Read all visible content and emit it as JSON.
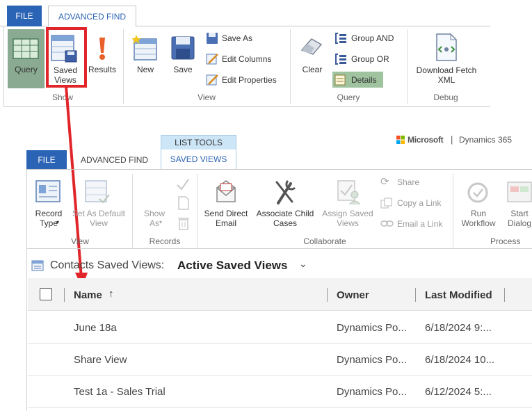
{
  "top_ribbon": {
    "tabs": {
      "file": "FILE",
      "advanced_find": "ADVANCED FIND"
    },
    "show": {
      "query": "Query",
      "saved_views": "Saved\nViews",
      "results": "Results",
      "section": "Show"
    },
    "view": {
      "new": "New",
      "save": "Save",
      "save_as": "Save As",
      "edit_columns": "Edit Columns",
      "edit_properties": "Edit Properties",
      "section": "View"
    },
    "query": {
      "clear": "Clear",
      "group_and": "Group AND",
      "group_or": "Group OR",
      "details": "Details",
      "section": "Query"
    },
    "debug": {
      "download_fetch_xml": "Download Fetch\nXML",
      "section": "Debug"
    }
  },
  "bottom_ribbon": {
    "brand": {
      "microsoft": "Microsoft",
      "product": "Dynamics 365"
    },
    "tabs": {
      "file": "FILE",
      "advanced_find": "ADVANCED FIND",
      "context_group": "LIST TOOLS",
      "saved_views": "SAVED VIEWS"
    },
    "view": {
      "record_type": "Record\nType",
      "set_default_view": "Set As Default\nView",
      "section": "View"
    },
    "records": {
      "show_as": "Show\nAs",
      "section": "Records"
    },
    "collaborate": {
      "send_direct_email": "Send Direct\nEmail",
      "associate_child_cases": "Associate Child\nCases",
      "assign_saved_views": "Assign Saved\nViews",
      "share": "Share",
      "copy_link": "Copy a Link",
      "email_link": "Email a Link",
      "section": "Collaborate"
    },
    "process": {
      "run_workflow": "Run\nWorkflow",
      "start_dialog": "Start\nDialog",
      "section": "Process"
    }
  },
  "view_header": {
    "prefix": "Contacts Saved Views:",
    "selected": "Active Saved Views"
  },
  "grid": {
    "columns": [
      "Name",
      "Owner",
      "Last Modified"
    ],
    "rows": [
      {
        "name": "June 18a",
        "owner": "Dynamics Po...",
        "modified": "6/18/2024 9:..."
      },
      {
        "name": "Share View",
        "owner": "Dynamics Po...",
        "modified": "6/18/2024 10..."
      },
      {
        "name": "Test 1a - Sales Trial",
        "owner": "Dynamics Po...",
        "modified": "6/12/2024 5:..."
      }
    ]
  },
  "colors": {
    "file_tab": "#2b63b5",
    "highlight": "#e0262b",
    "query_selected": "#8aaa92",
    "details_selected": "#9fc29f",
    "context_tab": "#cde6f7"
  }
}
